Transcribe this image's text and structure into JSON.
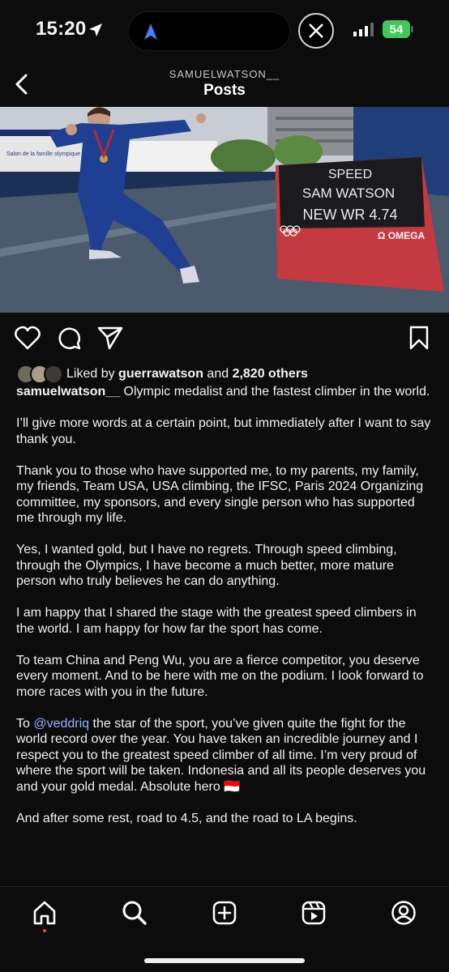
{
  "status_bar": {
    "time": "15:20",
    "battery": "54"
  },
  "header": {
    "username": "SAMUELWATSON__",
    "title": "Posts"
  },
  "photo": {
    "board_line1": "SPEED",
    "board_line2": "SAM WATSON",
    "board_line3": "NEW WR 4.74",
    "board_brand": "Ω OMEGA",
    "bg_sign": "Salon de la famille olympique"
  },
  "likes": {
    "prefix": "Liked by ",
    "user": "guerrawatson",
    "middle": " and ",
    "count": "2,820 others"
  },
  "caption": {
    "author": "samuelwatson__",
    "p1": " Olympic medalist and the fastest climber in the world.",
    "p2": "I’ll give more words at a certain point, but immediately after I want to say thank you.",
    "p3": "Thank you to those who have supported me, to my parents, my family, my friends, Team USA, USA climbing, the IFSC, Paris 2024 Organizing committee, my sponsors, and every single person who has supported me through my life.",
    "p4": "Yes, I wanted gold, but I have no regrets. Through speed climbing, through the Olympics, I have become a much better, more mature person who truly believes he can do anything.",
    "p5": "I am happy that I shared the stage with the greatest speed climbers in the world. I am happy for how far the sport has come.",
    "p6": "To team China and Peng Wu, you are a fierce competitor, you deserve every moment. And to be here with me on the podium. I look forward to more races with you in the future.",
    "p7_pre": "To ",
    "p7_mention": "@veddriq",
    "p7_post": " the star of the sport, you’ve given quite the fight for the world record over the year. You have taken an incredible journey and I respect you to the greatest speed climber of all time. I’m very proud of where the sport will be taken. Indonesia and all its people deserves you and your gold medal. Absolute hero 🇮🇩",
    "p8": "And after some rest, road to 4.5, and the road to LA begins."
  },
  "icons": {
    "actions": [
      "heart-icon",
      "comment-icon",
      "share-icon",
      "bookmark-icon"
    ],
    "tabs": [
      "home-icon",
      "search-icon",
      "create-icon",
      "reels-icon",
      "profile-icon"
    ]
  },
  "colors": {
    "background": "#0c0c0c",
    "battery": "#3ec95a",
    "mention": "#8fb4ff",
    "notification_dot": "#ff3b4a"
  }
}
